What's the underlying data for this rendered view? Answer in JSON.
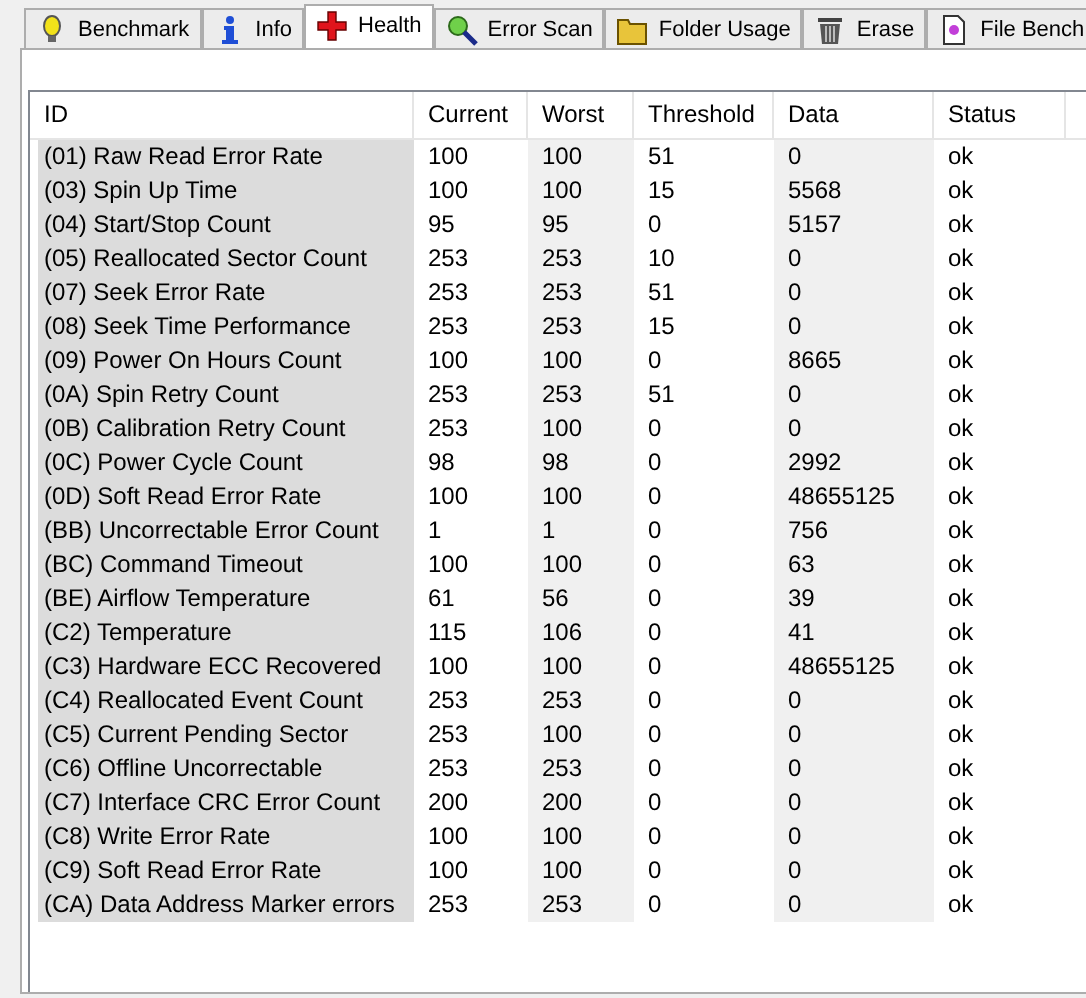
{
  "tabs": [
    {
      "label": "Benchmark",
      "selected": false
    },
    {
      "label": "Info",
      "selected": false
    },
    {
      "label": "Health",
      "selected": true
    },
    {
      "label": "Error Scan",
      "selected": false
    },
    {
      "label": "Folder Usage",
      "selected": false
    },
    {
      "label": "Erase",
      "selected": false
    },
    {
      "label": "File Bench",
      "selected": false
    }
  ],
  "table": {
    "columns": [
      "ID",
      "Current",
      "Worst",
      "Threshold",
      "Data",
      "Status"
    ],
    "rows": [
      [
        "(01) Raw Read Error Rate",
        "100",
        "100",
        "51",
        "0",
        "ok"
      ],
      [
        "(03) Spin Up Time",
        "100",
        "100",
        "15",
        "5568",
        "ok"
      ],
      [
        "(04) Start/Stop Count",
        "95",
        "95",
        "0",
        "5157",
        "ok"
      ],
      [
        "(05) Reallocated Sector Count",
        "253",
        "253",
        "10",
        "0",
        "ok"
      ],
      [
        "(07) Seek Error Rate",
        "253",
        "253",
        "51",
        "0",
        "ok"
      ],
      [
        "(08) Seek Time Performance",
        "253",
        "253",
        "15",
        "0",
        "ok"
      ],
      [
        "(09) Power On Hours Count",
        "100",
        "100",
        "0",
        "8665",
        "ok"
      ],
      [
        "(0A) Spin Retry Count",
        "253",
        "253",
        "51",
        "0",
        "ok"
      ],
      [
        "(0B) Calibration Retry Count",
        "253",
        "100",
        "0",
        "0",
        "ok"
      ],
      [
        "(0C) Power Cycle Count",
        "98",
        "98",
        "0",
        "2992",
        "ok"
      ],
      [
        "(0D) Soft Read Error Rate",
        "100",
        "100",
        "0",
        "48655125",
        "ok"
      ],
      [
        "(BB) Uncorrectable Error Count",
        "1",
        "1",
        "0",
        "756",
        "ok"
      ],
      [
        "(BC) Command Timeout",
        "100",
        "100",
        "0",
        "63",
        "ok"
      ],
      [
        "(BE) Airflow Temperature",
        "61",
        "56",
        "0",
        "39",
        "ok"
      ],
      [
        "(C2) Temperature",
        "115",
        "106",
        "0",
        "41",
        "ok"
      ],
      [
        "(C3) Hardware ECC Recovered",
        "100",
        "100",
        "0",
        "48655125",
        "ok"
      ],
      [
        "(C4) Reallocated Event Count",
        "253",
        "253",
        "0",
        "0",
        "ok"
      ],
      [
        "(C5) Current Pending Sector",
        "253",
        "100",
        "0",
        "0",
        "ok"
      ],
      [
        "(C6) Offline Uncorrectable",
        "253",
        "253",
        "0",
        "0",
        "ok"
      ],
      [
        "(C7) Interface CRC Error Count",
        "200",
        "200",
        "0",
        "0",
        "ok"
      ],
      [
        "(C8) Write Error Rate",
        "100",
        "100",
        "0",
        "0",
        "ok"
      ],
      [
        "(C9) Soft Read Error Rate",
        "100",
        "100",
        "0",
        "0",
        "ok"
      ],
      [
        "(CA) Data Address Marker errors",
        "253",
        "253",
        "0",
        "0",
        "ok"
      ]
    ]
  }
}
